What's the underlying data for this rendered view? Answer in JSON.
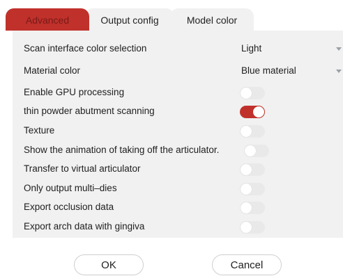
{
  "tabs": [
    {
      "label": "Advanced",
      "active": true
    },
    {
      "label": "Output config",
      "active": false
    },
    {
      "label": "Model color",
      "active": false
    }
  ],
  "settings": {
    "scan_color": {
      "label": "Scan interface color selection",
      "value": "Light"
    },
    "material_color": {
      "label": "Material color",
      "value": "Blue material"
    },
    "gpu": {
      "label": "Enable GPU processing",
      "on": false
    },
    "thin_powder": {
      "label": "thin powder abutment scanning",
      "on": true
    },
    "texture": {
      "label": "Texture",
      "on": false
    },
    "animation": {
      "label": "Show the animation of taking off the articulator.",
      "on": false
    },
    "virtual_articulator": {
      "label": "Transfer to virtual articulator",
      "on": false
    },
    "multi_dies": {
      "label": "Only output multi–dies",
      "on": false
    },
    "occlusion": {
      "label": "Export occlusion data",
      "on": false
    },
    "arch_gingiva": {
      "label": "Export arch data with gingiva",
      "on": false
    }
  },
  "buttons": {
    "ok": "OK",
    "cancel": "Cancel"
  },
  "colors": {
    "accent": "#c0312b",
    "panel": "#f1f1f1",
    "toggle_off": "#e9e9e9"
  }
}
